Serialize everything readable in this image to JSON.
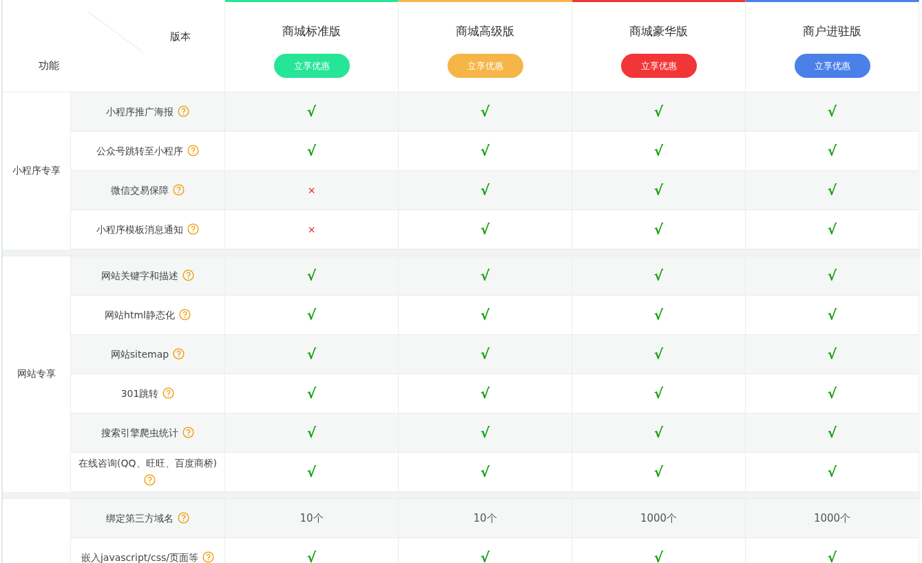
{
  "header": {
    "version_label": "版本",
    "feature_label": "功能",
    "plans": [
      {
        "name": "商城标准版",
        "button": "立享优惠",
        "color": "#26e597"
      },
      {
        "name": "商城高级版",
        "button": "立享优惠",
        "color": "#f6b547"
      },
      {
        "name": "商城豪华版",
        "button": "立享优惠",
        "color": "#f23537"
      },
      {
        "name": "商户进驻版",
        "button": "立享优惠",
        "color": "#4b80e9"
      }
    ]
  },
  "groups": [
    {
      "label": "小程序专享",
      "rows": [
        {
          "feature": "小程序推广海报",
          "help": true,
          "cells": [
            {
              "kind": "yes",
              "text": "√"
            },
            {
              "kind": "yes",
              "text": "√"
            },
            {
              "kind": "yes",
              "text": "√"
            },
            {
              "kind": "yes",
              "text": "√"
            }
          ]
        },
        {
          "feature": "公众号跳转至小程序",
          "help": true,
          "cells": [
            {
              "kind": "yes",
              "text": "√"
            },
            {
              "kind": "yes",
              "text": "√"
            },
            {
              "kind": "yes",
              "text": "√"
            },
            {
              "kind": "yes",
              "text": "√"
            }
          ]
        },
        {
          "feature": "微信交易保障",
          "help": true,
          "cells": [
            {
              "kind": "no",
              "text": "×"
            },
            {
              "kind": "yes",
              "text": "√"
            },
            {
              "kind": "yes",
              "text": "√"
            },
            {
              "kind": "yes",
              "text": "√"
            }
          ]
        },
        {
          "feature": "小程序模板消息通知",
          "help": true,
          "cells": [
            {
              "kind": "no",
              "text": "×"
            },
            {
              "kind": "yes",
              "text": "√"
            },
            {
              "kind": "yes",
              "text": "√"
            },
            {
              "kind": "yes",
              "text": "√"
            }
          ]
        }
      ]
    },
    {
      "label": "网站专享",
      "rows": [
        {
          "feature": "网站关键字和描述",
          "help": true,
          "cells": [
            {
              "kind": "yes",
              "text": "√"
            },
            {
              "kind": "yes",
              "text": "√"
            },
            {
              "kind": "yes",
              "text": "√"
            },
            {
              "kind": "yes",
              "text": "√"
            }
          ]
        },
        {
          "feature": "网站html静态化",
          "help": true,
          "cells": [
            {
              "kind": "yes",
              "text": "√"
            },
            {
              "kind": "yes",
              "text": "√"
            },
            {
              "kind": "yes",
              "text": "√"
            },
            {
              "kind": "yes",
              "text": "√"
            }
          ]
        },
        {
          "feature": "网站sitemap",
          "help": true,
          "cells": [
            {
              "kind": "yes",
              "text": "√"
            },
            {
              "kind": "yes",
              "text": "√"
            },
            {
              "kind": "yes",
              "text": "√"
            },
            {
              "kind": "yes",
              "text": "√"
            }
          ]
        },
        {
          "feature": "301跳转",
          "help": true,
          "cells": [
            {
              "kind": "yes",
              "text": "√"
            },
            {
              "kind": "yes",
              "text": "√"
            },
            {
              "kind": "yes",
              "text": "√"
            },
            {
              "kind": "yes",
              "text": "√"
            }
          ]
        },
        {
          "feature": "搜索引擎爬虫统计",
          "help": true,
          "cells": [
            {
              "kind": "yes",
              "text": "√"
            },
            {
              "kind": "yes",
              "text": "√"
            },
            {
              "kind": "yes",
              "text": "√"
            },
            {
              "kind": "yes",
              "text": "√"
            }
          ]
        },
        {
          "feature": "在线咨询(QQ、旺旺、百度商桥)",
          "help": true,
          "cells": [
            {
              "kind": "yes",
              "text": "√"
            },
            {
              "kind": "yes",
              "text": "√"
            },
            {
              "kind": "yes",
              "text": "√"
            },
            {
              "kind": "yes",
              "text": "√"
            }
          ]
        }
      ]
    },
    {
      "rows": [
        {
          "feature": "绑定第三方域名",
          "help": true,
          "cells": [
            {
              "kind": "value",
              "text": "10个"
            },
            {
              "kind": "value",
              "text": "10个"
            },
            {
              "kind": "value",
              "text": "1000个"
            },
            {
              "kind": "value",
              "text": "1000个"
            }
          ]
        },
        {
          "feature": "嵌入javascript/css/页面等",
          "help": true,
          "cells": [
            {
              "kind": "yes",
              "text": "√"
            },
            {
              "kind": "yes",
              "text": "√"
            },
            {
              "kind": "yes",
              "text": "√"
            },
            {
              "kind": "yes",
              "text": "√"
            }
          ]
        }
      ]
    }
  ]
}
